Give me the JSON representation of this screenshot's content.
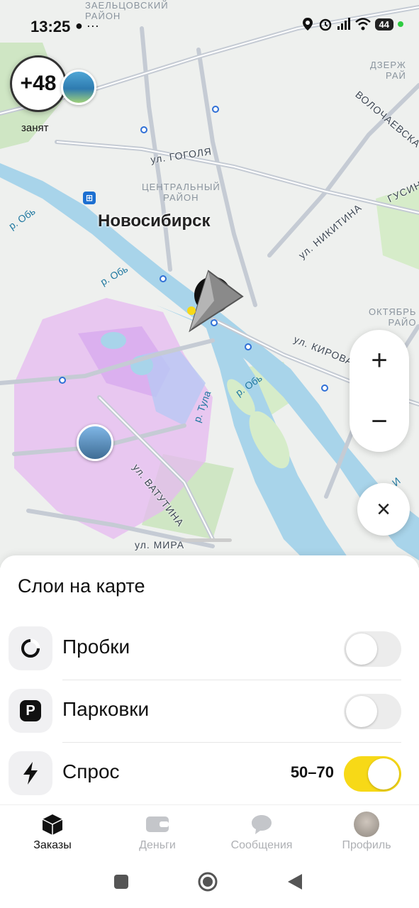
{
  "status_bar": {
    "time": "13:25",
    "left_icons": "● ···",
    "battery": "44"
  },
  "map": {
    "city": "Новосибирск",
    "districts": [
      "ЗАЕЛЬЦОВСКИЙ РАЙОН",
      "ЦЕНТРАЛЬНЫЙ РАЙОН",
      "ДЗЕРЖ РАЙ",
      "ОКТЯБРЬ РАЙО"
    ],
    "district_top": "ЗАЕЛЬЦОВСКИЙ",
    "district_top2": "РАЙОН",
    "district_center": "ЦЕНТРАЛЬНЫЙ",
    "district_center2": "РАЙОН",
    "district_right1": "ДЗЕРЖ",
    "district_right1b": "РАЙ",
    "district_right2": "ОКТЯБРЬ",
    "district_right2b": "РАЙО",
    "streets": {
      "gogolya": "ул. ГОГОЛЯ",
      "nikitina": "ул. НИКИТИНА",
      "kirova": "ул. КИРОВА",
      "vatutina": "ул. ВАТУТИНА",
      "mira": "ул. МИРА",
      "volochaevskaya": "ВОЛОЧАЕВСКА",
      "gusin": "ГУСИН",
      "tula": "р. Тула",
      "ob1": "р. Обь",
      "ob2": "р. Обь",
      "ob3": "р. Обь",
      "inya": "р. И"
    }
  },
  "driver": {
    "rating_delta": "+48",
    "status": "занят"
  },
  "map_controls": {
    "zoom_in": "+",
    "zoom_out": "−",
    "close": "×"
  },
  "layers_sheet": {
    "title": "Слои на карте",
    "rows": [
      {
        "label": "Пробки",
        "value": "",
        "enabled": false
      },
      {
        "label": "Парковки",
        "value": "",
        "enabled": false
      },
      {
        "label": "Спрос",
        "value": "50–70",
        "enabled": true
      }
    ]
  },
  "tabs": [
    {
      "label": "Заказы",
      "active": true
    },
    {
      "label": "Деньги",
      "active": false
    },
    {
      "label": "Сообщения",
      "active": false
    },
    {
      "label": "Профиль",
      "active": false
    }
  ],
  "colors": {
    "accent_yellow": "#f7d917",
    "water": "#a8d4ea",
    "demand_zone": "#e6b9f0"
  }
}
